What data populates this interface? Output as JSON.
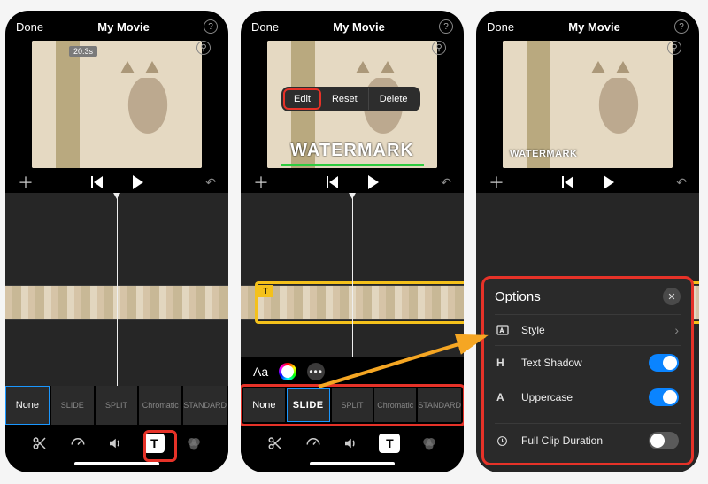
{
  "header": {
    "done": "Done",
    "title": "My Movie",
    "help": "?"
  },
  "preview": {
    "duration_badge": "20.3s",
    "watermark_text": "WATERMARK"
  },
  "edit_menu": {
    "edit": "Edit",
    "reset": "Reset",
    "delete": "Delete"
  },
  "clip": {
    "t_label": "T"
  },
  "aa_row": {
    "aa": "Aa",
    "more": "•••"
  },
  "styles": {
    "none": "None",
    "slide": "SLIDE",
    "split": "SPLIT",
    "chromatic": "Chromatic",
    "standard": "STANDARD"
  },
  "options": {
    "title": "Options",
    "style": "Style",
    "text_shadow": "Text Shadow",
    "uppercase": "Uppercase",
    "full_clip": "Full Clip Duration"
  },
  "icons": {
    "plus": "＋",
    "undo": "↶",
    "zoom": "⚲",
    "close": "✕",
    "chevron": "›"
  }
}
